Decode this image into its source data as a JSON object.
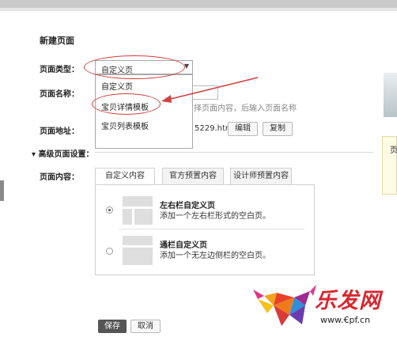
{
  "page": {
    "title": "新建页面",
    "page_type_label": "页面类型：",
    "page_name_label": "页面名称：",
    "page_url_label": "页面地址：",
    "advanced_label": "高级页面设置：",
    "content_label": "页面内容："
  },
  "page_type_select": {
    "value": "自定义页",
    "options": [
      "自定义页",
      "宝贝详情模板",
      "宝贝列表模板"
    ]
  },
  "page_name": {
    "hint": "择页面内容，后输入页面名称"
  },
  "page_url": {
    "suffix": "5229.htm",
    "edit_label": "编辑",
    "copy_label": "复制"
  },
  "tabs": [
    "自定义内容",
    "官方预置内容",
    "设计师预置内容"
  ],
  "options": [
    {
      "title": "左右栏自定义页",
      "desc": "添加一个左右栏形式的空白页。",
      "selected": true
    },
    {
      "title": "通栏自定义页",
      "desc": "添加一个无左边侧栏的空白页。",
      "selected": false
    }
  ],
  "footer": {
    "save_label": "保存",
    "cancel_label": "取消"
  },
  "right_panel": {
    "text": "页"
  },
  "watermark": {
    "name": "乐发网",
    "url": "www.€pf.cn"
  }
}
